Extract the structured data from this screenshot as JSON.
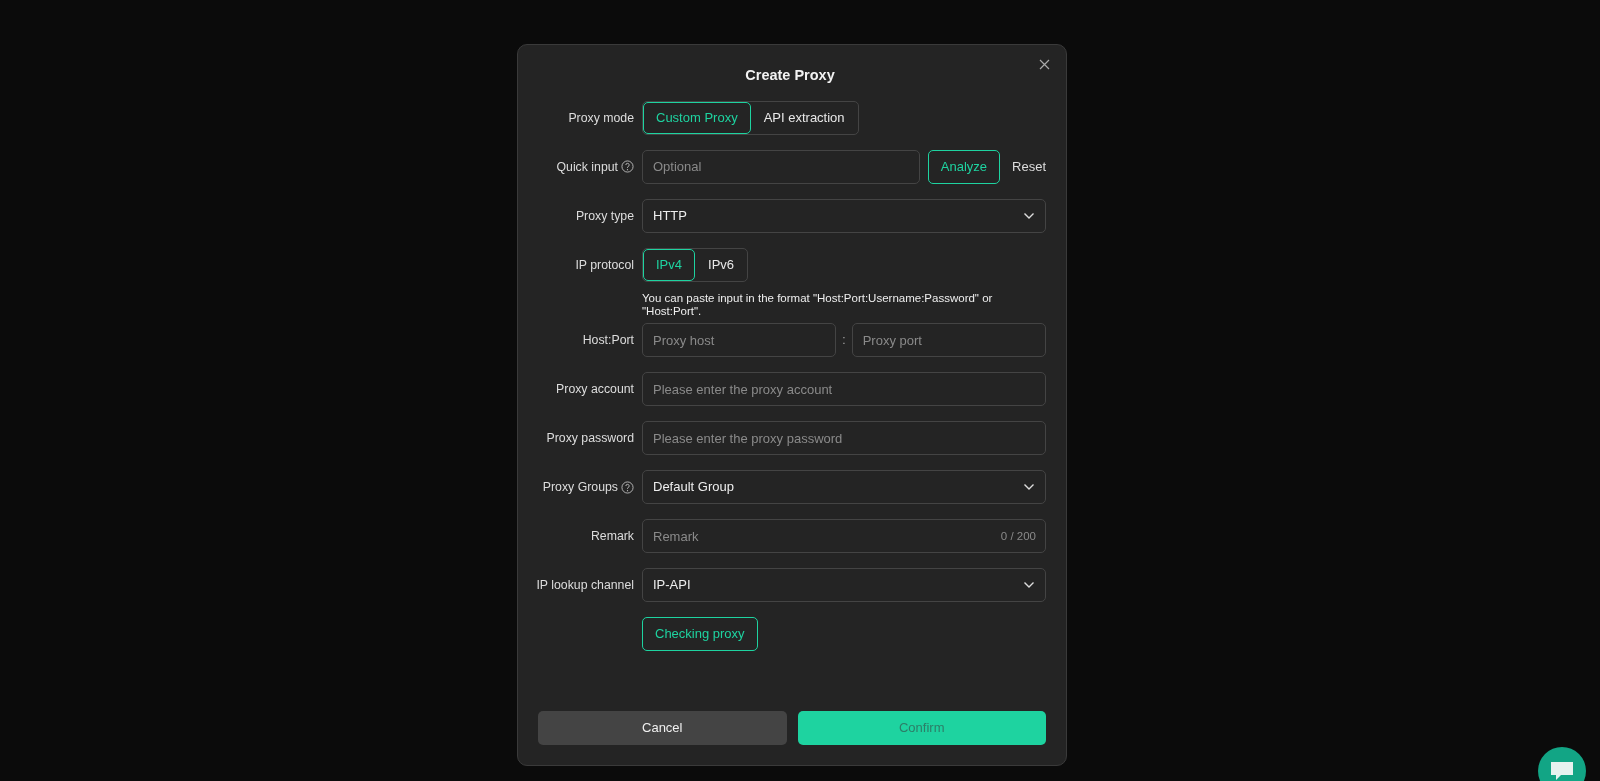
{
  "dialog": {
    "title": "Create Proxy",
    "fields": [
      {
        "kind": "segmented",
        "label": "Proxy mode",
        "options": [
          {
            "label": "Custom Proxy",
            "selected": true
          },
          {
            "label": "API extraction",
            "selected": false
          }
        ]
      },
      {
        "kind": "quick",
        "label": "Quick input",
        "help": true,
        "placeholder": "Optional",
        "buttons": [
          "Analyze",
          "Reset"
        ]
      },
      {
        "kind": "select",
        "label": "Proxy type",
        "value": "HTTP"
      },
      {
        "kind": "segmented",
        "label": "IP protocol",
        "options": [
          {
            "label": "IPv4",
            "selected": true
          },
          {
            "label": "IPv6",
            "selected": false
          }
        ]
      },
      {
        "kind": "hint",
        "text": "You can paste input in the format \"Host:Port:Username:Password\" or \"Host:Port\"."
      },
      {
        "kind": "hostport",
        "label": "Host:Port",
        "placeholders": [
          "Proxy host",
          "Proxy port"
        ],
        "separator": ":"
      },
      {
        "kind": "text",
        "label": "Proxy account",
        "placeholder": "Please enter the proxy account"
      },
      {
        "kind": "text",
        "label": "Proxy password",
        "placeholder": "Please enter the proxy password"
      },
      {
        "kind": "select",
        "label": "Proxy Groups",
        "help": true,
        "value": "Default Group"
      },
      {
        "kind": "text",
        "label": "Remark",
        "placeholder": "Remark",
        "counter": "0 / 200"
      },
      {
        "kind": "select",
        "label": "IP lookup channel",
        "value": "IP-API"
      },
      {
        "kind": "button",
        "text": "Checking proxy"
      }
    ],
    "footer": {
      "cancel": "Cancel",
      "confirm": "Confirm"
    }
  }
}
